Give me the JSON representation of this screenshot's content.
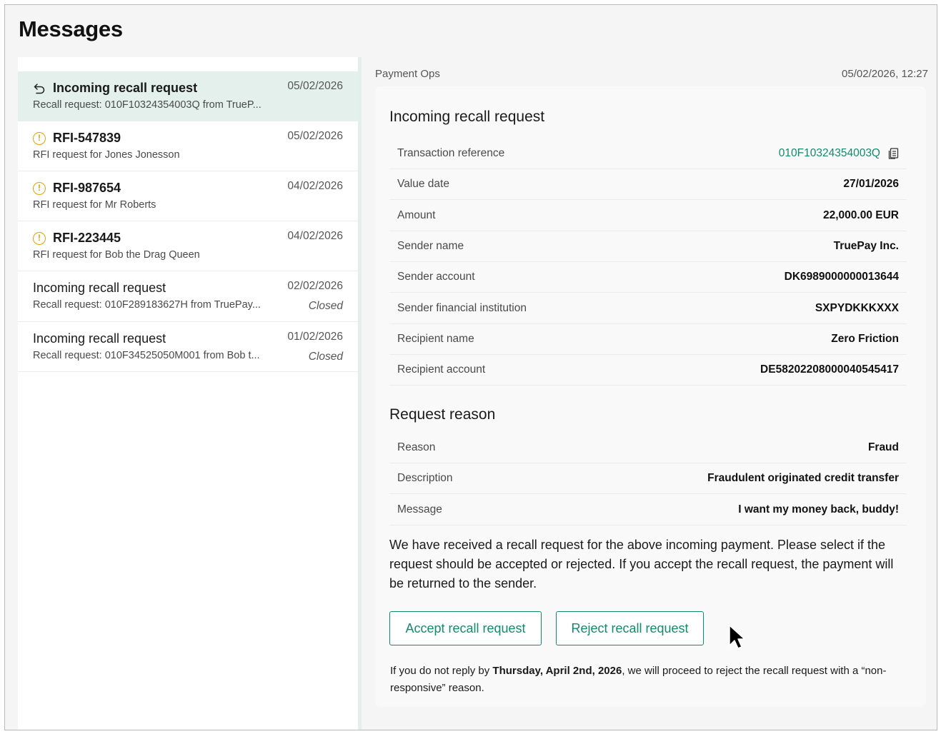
{
  "page": {
    "title": "Messages"
  },
  "messages": [
    {
      "icon": "undo-icon",
      "title": "Incoming recall request",
      "subtitle": "Recall request: 010F10324354003Q from TrueP...",
      "date": "05/02/2026",
      "status": "",
      "bold": true,
      "active": true
    },
    {
      "icon": "warning-icon",
      "title": "RFI-547839",
      "subtitle": "RFI request for Jones Jonesson",
      "date": "05/02/2026",
      "status": "",
      "bold": true,
      "active": false
    },
    {
      "icon": "warning-icon",
      "title": "RFI-987654",
      "subtitle": "RFI request for Mr Roberts",
      "date": "04/02/2026",
      "status": "",
      "bold": true,
      "active": false
    },
    {
      "icon": "warning-icon",
      "title": "RFI-223445",
      "subtitle": "RFI request for Bob the Drag Queen",
      "date": "04/02/2026",
      "status": "",
      "bold": true,
      "active": false
    },
    {
      "icon": "",
      "title": "Incoming recall request",
      "subtitle": "Recall request: 010F289183627H from TruePay...",
      "date": "02/02/2026",
      "status": "Closed",
      "bold": false,
      "active": false
    },
    {
      "icon": "",
      "title": "Incoming recall request",
      "subtitle": "Recall request: 010F34525050M001 from Bob t...",
      "date": "01/02/2026",
      "status": "Closed",
      "bold": false,
      "active": false
    }
  ],
  "detail": {
    "team": "Payment Ops",
    "timestamp": "05/02/2026, 12:27",
    "heading": "Incoming recall request",
    "fields": [
      {
        "label": "Transaction reference",
        "value": "010F10324354003Q",
        "link": true,
        "icon": "copy-icon"
      },
      {
        "label": "Value date",
        "value": "27/01/2026"
      },
      {
        "label": "Amount",
        "value": "22,000.00 EUR"
      },
      {
        "label": "Sender name",
        "value": "TruePay Inc."
      },
      {
        "label": "Sender account",
        "value": "DK6989000000013644"
      },
      {
        "label": "Sender financial institution",
        "value": "SXPYDKKKXXX"
      },
      {
        "label": "Recipient name",
        "value": "Zero Friction"
      },
      {
        "label": "Recipient account",
        "value": "DE58202208000040545417"
      }
    ],
    "reason_heading": "Request reason",
    "reason_fields": [
      {
        "label": "Reason",
        "value": "Fraud"
      },
      {
        "label": "Description",
        "value": "Fraudulent originated credit transfer"
      },
      {
        "label": "Message",
        "value": "I want my money back, buddy!"
      }
    ],
    "paragraph": "We have received a recall request for the above incoming payment. Please select if the request should be accepted or rejected. If you accept the recall request, the payment will be returned to the sender.",
    "accept_label": "Accept recall request",
    "reject_label": "Reject recall request",
    "note_prefix": "If you do not reply by ",
    "note_deadline": "Thursday, April 2nd, 2026",
    "note_suffix": ", we will proceed to reject the recall request with a “non-responsive” reason."
  },
  "colors": {
    "accent": "#148a6c",
    "active_row": "#e3f0ec",
    "warning": "#e8a100"
  },
  "cursor": {
    "icon": "mouse-pointer-icon"
  }
}
